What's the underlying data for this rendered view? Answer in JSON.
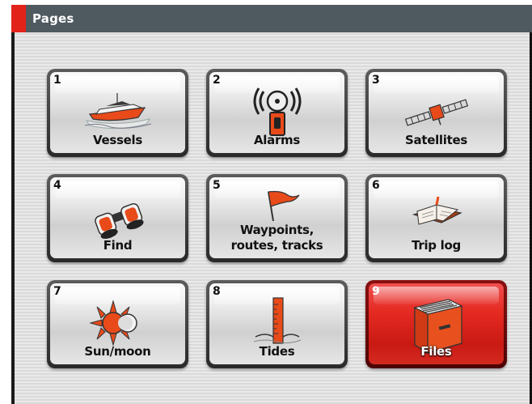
{
  "header": {
    "title": "Pages",
    "accent_color": "#e2231a",
    "bar_color": "#4e5a60"
  },
  "tiles": [
    {
      "number": "1",
      "label": "Vessels",
      "icon": "vessel-icon",
      "selected": false
    },
    {
      "number": "2",
      "label": "Alarms",
      "icon": "alarm-icon",
      "selected": false
    },
    {
      "number": "3",
      "label": "Satellites",
      "icon": "satellite-icon",
      "selected": false
    },
    {
      "number": "4",
      "label": "Find",
      "icon": "binoculars-icon",
      "selected": false
    },
    {
      "number": "5",
      "label_line1": "Waypoints,",
      "label_line2": "routes, tracks",
      "icon": "flag-icon",
      "selected": false
    },
    {
      "number": "6",
      "label": "Trip log",
      "icon": "logbook-icon",
      "selected": false
    },
    {
      "number": "7",
      "label": "Sun/moon",
      "icon": "sun-moon-icon",
      "selected": false
    },
    {
      "number": "8",
      "label": "Tides",
      "icon": "tide-gauge-icon",
      "selected": false
    },
    {
      "number": "9",
      "label": "Files",
      "icon": "file-drawer-icon",
      "selected": true
    }
  ],
  "selected_color": "#e52a22"
}
